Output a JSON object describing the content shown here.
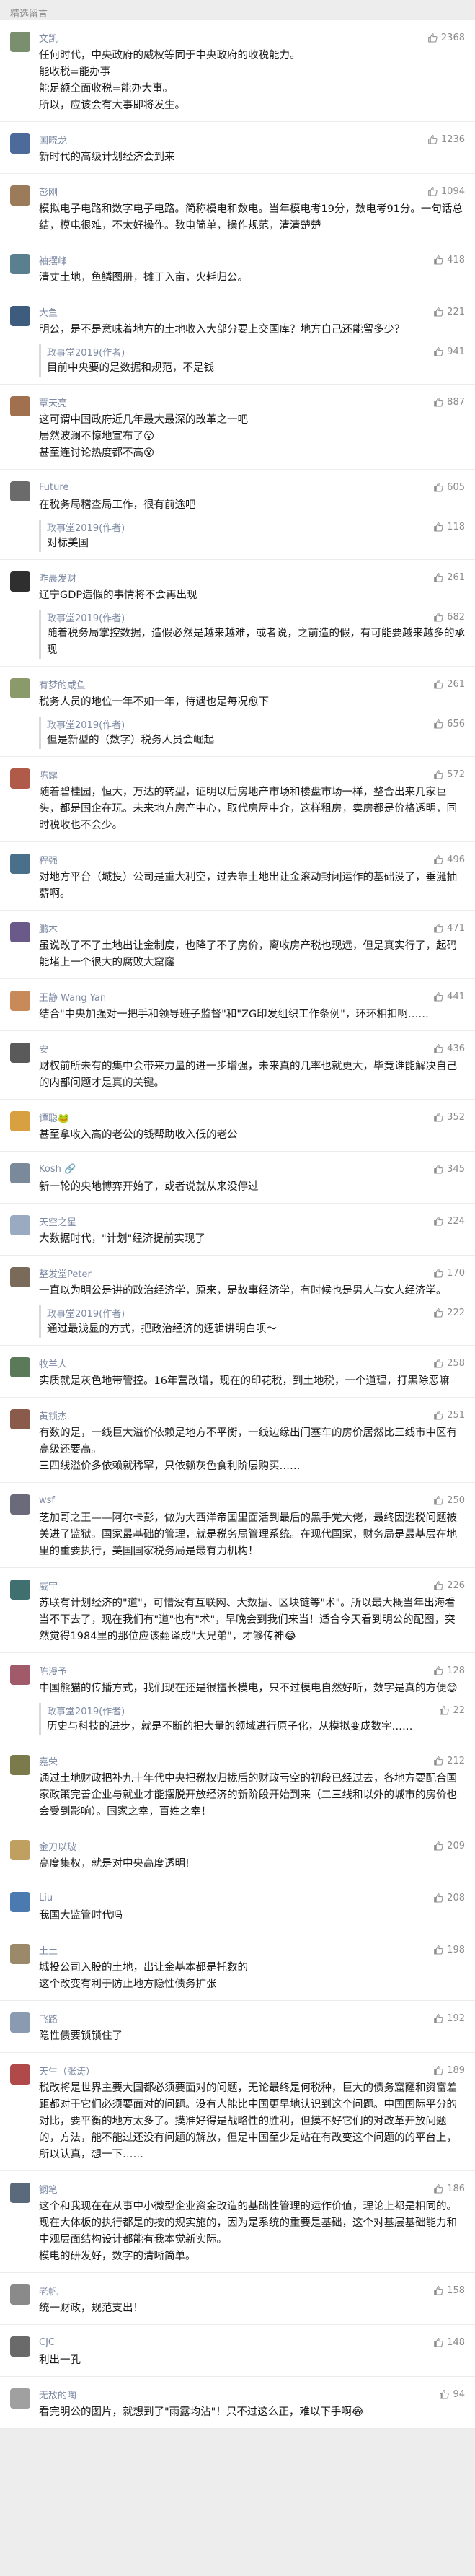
{
  "section_title": "精选留言",
  "colors": {
    "name": "#7d8aa3",
    "muted": "#8c8c8c",
    "background": "#ededed",
    "reply_bar": "#d9d9d9"
  },
  "comments": [
    {
      "name": "文凯",
      "likes": "2368",
      "avatar_color": "#7a8f6e",
      "text": "任何时代，中央政府的威权等同于中央政府的收税能力。\n能收税=能办事\n能足额全面收税=能办大事。\n所以，应该会有大事即将发生。"
    },
    {
      "name": "国晓龙",
      "likes": "1236",
      "avatar_color": "#4d6b9a",
      "text": "新时代的高级计划经济会到来"
    },
    {
      "name": "彭刚",
      "likes": "1094",
      "avatar_color": "#9c7b5a",
      "text": "模拟电子电路和数字电子电路。简称模电和数电。当年模电考19分，数电考91分。一句话总结，模电很难，不太好操作。数电简单，操作规范，清清楚楚"
    },
    {
      "name": "袖摆峰",
      "likes": "418",
      "avatar_color": "#5a7f8f",
      "text": "清丈土地，鱼鳞图册，摊丁入亩，火耗归公。"
    },
    {
      "name": "大鱼",
      "likes": "221",
      "avatar_color": "#3e5c7e",
      "text": "明公，是不是意味着地方的土地收入大部分要上交国库？地方自己还能留多少？",
      "reply": {
        "name": "政事堂2019(作者)",
        "likes": "941",
        "text": "目前中央要的是数据和规范，不是钱"
      }
    },
    {
      "name": "覃天亮",
      "likes": "887",
      "avatar_color": "#a0704f",
      "text": "这可谓中国政府近几年最大最深的改革之一吧\n居然波澜不惊地宣布了😮\n甚至连讨论热度都不高😮"
    },
    {
      "name": "Future",
      "likes": "605",
      "avatar_color": "#6b6b6b",
      "text": "在税务局稽查局工作，很有前途吧",
      "reply": {
        "name": "政事堂2019(作者)",
        "likes": "118",
        "text": "对标美国"
      }
    },
    {
      "name": "昨晨发财",
      "likes": "261",
      "avatar_color": "#2f2f2f",
      "text": "辽宁GDP造假的事情将不会再出现",
      "reply": {
        "name": "政事堂2019(作者)",
        "likes": "682",
        "text": "随着税务局掌控数据，造假必然是越来越难，或者说，之前造的假，有可能要越来越多的承现"
      }
    },
    {
      "name": "有梦的咸鱼",
      "likes": "261",
      "avatar_color": "#8a9a6a",
      "text": "税务人员的地位一年不如一年，待遇也是每况愈下",
      "reply": {
        "name": "政事堂2019(作者)",
        "likes": "656",
        "text": "但是新型的（数字）税务人员会崛起"
      }
    },
    {
      "name": "陈露",
      "likes": "572",
      "avatar_color": "#b05a4a",
      "text": "随着碧桂园，恒大，万达的转型，证明以后房地产市场和楼盘市场一样，整合出来几家巨头，都是国企在玩。未来地方房产中心，取代房屋中介，这样租房，卖房都是价格透明，同时税收也不会少。"
    },
    {
      "name": "程强",
      "likes": "496",
      "avatar_color": "#4a6f8a",
      "text": "对地方平台（城投）公司是重大利空，过去靠土地出让金滚动封闭运作的基础没了，垂涎抽薪啊。"
    },
    {
      "name": "鹏木",
      "likes": "471",
      "avatar_color": "#6a5a8a",
      "text": "虽说改了不了土地出让金制度，也降了不了房价，离收房产税也现远，但是真实行了，起码能堵上一个很大的腐败大窟窿"
    },
    {
      "name": "王静 Wang Yan",
      "likes": "441",
      "avatar_color": "#c98a5a",
      "text": "结合\"中央加强对一把手和领导班子监督\"和\"ZG印发组织工作条例\"，环环相扣啊……"
    },
    {
      "name": "安",
      "likes": "436",
      "avatar_color": "#5a5a5a",
      "text": "财权前所未有的集中会带来力量的进一步增强，未来真的几率也就更大，毕竟谁能解决自己的内部问题才是真的关键。"
    },
    {
      "name": "谭聪🐸",
      "likes": "352",
      "avatar_color": "#d8a040",
      "text": "甚至拿收入高的老公的钱帮助收入低的老公"
    },
    {
      "name": "Kosh 🔗",
      "likes": "345",
      "avatar_color": "#7a8a9a",
      "text": "新一轮的央地博弈开始了，或者说就从来没停过"
    },
    {
      "name": "天空之星",
      "likes": "224",
      "avatar_color": "#9aaac0",
      "text": "大数据时代，\"计划\"经济提前实现了"
    },
    {
      "name": "整发堂Peter",
      "likes": "170",
      "avatar_color": "#7a6a5a",
      "text": "一直以为明公是讲的政治经济学，原来，是故事经济学，有时候也是男人与女人经济学。",
      "reply": {
        "name": "政事堂2019(作者)",
        "likes": "222",
        "text": "通过最浅显的方式，把政治经济的逻辑讲明白呗～"
      }
    },
    {
      "name": "牧羊人",
      "likes": "258",
      "avatar_color": "#5a7a5a",
      "text": "实质就是灰色地带管控。16年营改增，现在的印花税，到土地税，一个道理，打黑除恶嘛"
    },
    {
      "name": "黄锁杰",
      "likes": "251",
      "avatar_color": "#8a5a4a",
      "text": "有数的是，一线巨大溢价依赖是地方不平衡，一线边缘出门塞车的房价居然比三线市中区有高级还要高。\n三四线溢价多依赖就稀罕，只依赖灰色食利阶层购买……"
    },
    {
      "name": "wsf",
      "likes": "250",
      "avatar_color": "#6a6a7a",
      "text": "芝加哥之王——阿尔卡彭，做为大西洋帝国里面活到最后的黑手党大佬，最终因逃税问题被关进了监狱。国家最基础的管理，就是税务局管理系统。在现代国家，财务局是最基层在地里的重要执行，美国国家税务局是最有力机构！"
    },
    {
      "name": "威宇",
      "likes": "226",
      "avatar_color": "#3f6f6f",
      "text": "苏联有计划经济的\"道\"，可惜没有互联网、大数据、区块链等\"术\"。所以最大概当年出海看当不下去了，现在我们有\"道\"也有\"术\"，早晚会到我们来当！适合今天看到明公的配图，突然觉得1984里的那位应该翻译成\"大兄弟\"，才够传神😂"
    },
    {
      "name": "陈漫予",
      "likes": "128",
      "avatar_color": "#a05a6a",
      "text": "中国熊猫的传播方式，我们现在还是很擅长模电，只不过模电自然好听，数字是真的方便😊",
      "reply": {
        "name": "政事堂2019(作者)",
        "likes": "22",
        "text": "历史与科技的进步，就是不断的把大量的领域进行原子化，从模拟变成数字……"
      }
    },
    {
      "name": "嘉荣",
      "likes": "212",
      "avatar_color": "#7a7a4a",
      "text": "通过土地财政把补九十年代中央把税权归拢后的财政亏空的初段已经过去，各地方要配合国家政策完善企业与就业才能摆脱开放经济的新阶段开始到来（二三线和以外的城市的房价也会受到影响）。国家之幸，百姓之幸！"
    },
    {
      "name": "金刀以玻",
      "likes": "209",
      "avatar_color": "#c0a060",
      "text": "高度集权，就是对中央高度透明!"
    },
    {
      "name": "Liu",
      "likes": "208",
      "avatar_color": "#4a7ab0",
      "text": "我国大监管时代吗"
    },
    {
      "name": "土土",
      "likes": "198",
      "avatar_color": "#9a8a6a",
      "text": "城投公司入股的土地，出让金基本都是托数的\n这个改变有利于防止地方隐性债务扩张"
    },
    {
      "name": "飞路",
      "likes": "192",
      "avatar_color": "#8a9ab0",
      "text": "隐性债要锁锁住了"
    },
    {
      "name": "天生（张涛）",
      "likes": "189",
      "avatar_color": "#b04a4a",
      "text": "税改将是世界主要大国都必须要面对的问题，无论最终是何税种，巨大的债务窟窿和资富差距都对于它们必须要面对的问题。没有人能比中国更早地认识到这个问题。中国国际平分的对比，要平衡的地方太多了。摸准好得是战略性的胜利，但摸不好它们的对改革开放问题的，方法，能不能过还没有问题的解放，但是中国至少是站在有改变这个问题的的平台上，所以认真，想一下……"
    },
    {
      "name": "钢笔",
      "likes": "186",
      "avatar_color": "#5a6a7a",
      "text": "这个和我现在在从事中小微型企业资金改造的基础性管理的运作价值，理论上都是相同的。现在大体板的执行都是的按的规实施的，因为是系统的重要是基础，这个对基层基础能力和中观层面结构设计都能有我本觉新实际。\n模电的研发好，数字的清晰简单。"
    },
    {
      "name": "老帆",
      "likes": "158",
      "avatar_color": "#8a8a8a",
      "text": "统一财政，规范支出！"
    },
    {
      "name": "CJC",
      "likes": "148",
      "avatar_color": "#6a6a6a",
      "text": "利出一孔"
    },
    {
      "name": "无敌的陶",
      "likes": "94",
      "avatar_color": "#a0a0a0",
      "text": "看完明公的图片，就想到了\"雨露均沾\"！只不过这么正，难以下手啊😂"
    }
  ]
}
